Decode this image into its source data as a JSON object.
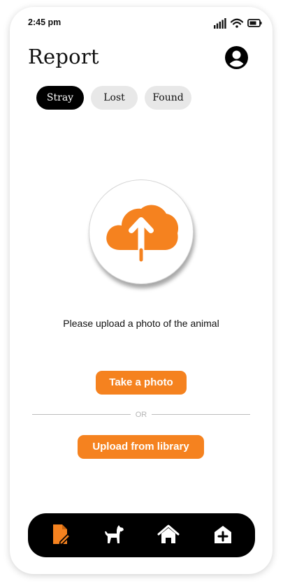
{
  "status_bar": {
    "time": "2:45 pm",
    "icons": [
      "signal-icon",
      "wifi-icon",
      "battery-icon"
    ]
  },
  "header": {
    "title": "Report",
    "profile_icon": "user-profile-icon"
  },
  "tabs": [
    {
      "label": "Stray",
      "active": true
    },
    {
      "label": "Lost",
      "active": false
    },
    {
      "label": "Found",
      "active": false
    }
  ],
  "upload": {
    "icon": "cloud-upload-icon",
    "instruction": "Please upload a photo of the animal"
  },
  "actions": {
    "take_photo_label": "Take a photo",
    "or_label": "OR",
    "upload_library_label": "Upload from library"
  },
  "bottom_nav": {
    "items": [
      {
        "icon": "report-icon",
        "active": true
      },
      {
        "icon": "dog-icon",
        "active": false
      },
      {
        "icon": "home-icon",
        "active": false
      },
      {
        "icon": "shelter-add-icon",
        "active": false
      }
    ]
  },
  "colors": {
    "accent": "#f5821f",
    "nav_background": "#000000",
    "tab_active": "#000000",
    "tab_inactive": "#e8e8e8"
  }
}
